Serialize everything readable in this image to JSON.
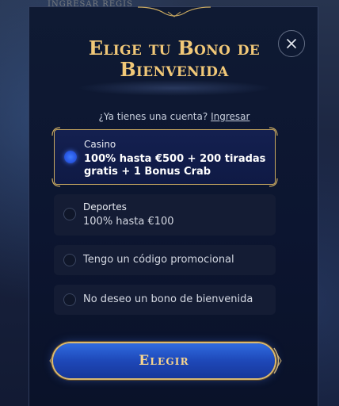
{
  "background": {
    "top_text": "INGRESAR   REGIS"
  },
  "modal": {
    "title_line1": "Elige tu Bono de",
    "title_line2": "Bienvenida",
    "account_prompt": "¿Ya tienes una cuenta?",
    "login_link": "Ingresar",
    "close_icon": "close-icon",
    "options": [
      {
        "category": "Casino",
        "line1": "100% hasta €500 + 200 tiradas",
        "line2": "gratis + 1 Bonus Crab",
        "selected": true
      },
      {
        "category": "Deportes",
        "line1": "100% hasta €100",
        "selected": false
      },
      {
        "label": "Tengo un código promocional",
        "selected": false
      },
      {
        "label": "No deseo un bono de bienvenida",
        "selected": false
      }
    ],
    "submit_label": "Elegir"
  },
  "colors": {
    "accent_gold": "#c9a961",
    "title_gold": "#f1c878",
    "button_blue": "#1e48b8",
    "radio_checked": "#3f7bff",
    "panel_bg": "#0c1530"
  }
}
